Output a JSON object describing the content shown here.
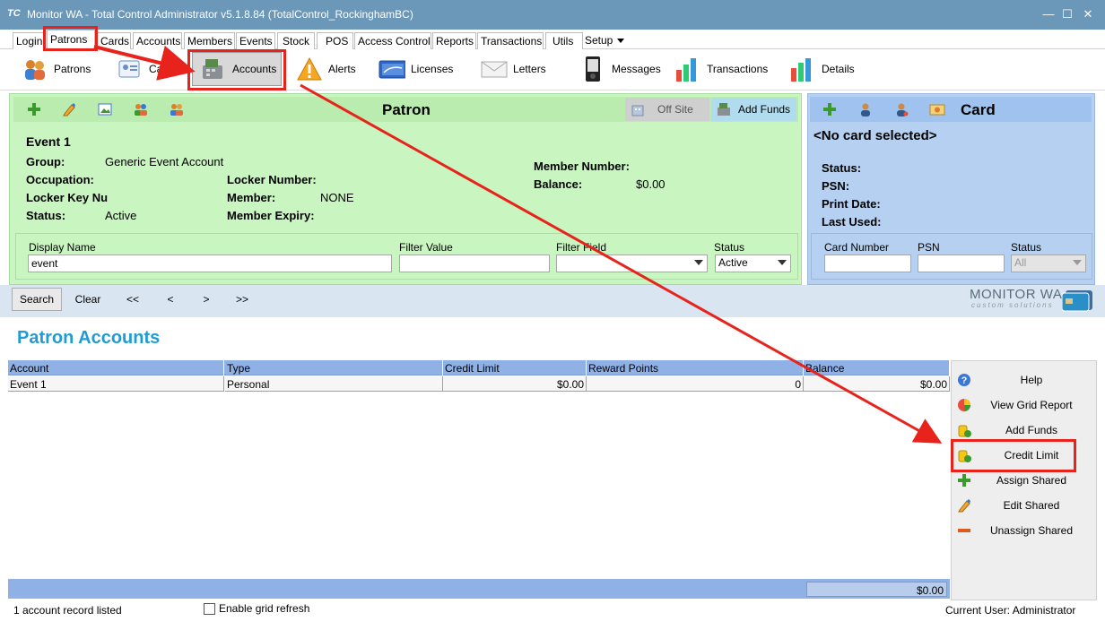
{
  "window": {
    "logo": "TC",
    "title": "Monitor WA - Total Control Administrator v5.1.8.84 (TotalControl_RockinghamBC)"
  },
  "menu_tabs": [
    "Login",
    "Patrons",
    "Cards",
    "Accounts",
    "Members",
    "Events",
    "Stock",
    "POS",
    "Access Control",
    "Reports",
    "Transactions",
    "Utils",
    "Setup"
  ],
  "toolbar": {
    "patrons": "Patrons",
    "cards": "Cards",
    "accounts": "Accounts",
    "alerts": "Alerts",
    "licenses": "Licenses",
    "letters": "Letters",
    "messages": "Messages",
    "transactions": "Transactions",
    "details": "Details"
  },
  "patron": {
    "heading": "Patron",
    "offsite": "Off Site",
    "add_funds": "Add Funds",
    "name": "Event 1",
    "group_label": "Group:",
    "group_value": "Generic Event Account",
    "occupation_label": "Occupation:",
    "locker_key_label": "Locker Key Nu",
    "status_label": "Status:",
    "status_value": "Active",
    "locker_number_label": "Locker Number:",
    "member_label": "Member:",
    "member_value": "NONE",
    "member_expiry_label": "Member Expiry:",
    "member_number_label": "Member Number:",
    "balance_label": "Balance:",
    "balance_value": "$0.00"
  },
  "filters": {
    "display_name_label": "Display Name",
    "display_name_value": "event",
    "filter_value_label": "Filter Value",
    "filter_field_label": "Filter Field",
    "status_label": "Status",
    "status_value": "Active"
  },
  "card": {
    "heading": "Card",
    "no_card": "<No card selected>",
    "status_label": "Status:",
    "psn_label": "PSN:",
    "print_date_label": "Print Date:",
    "last_used_label": "Last Used:",
    "card_number_label": "Card Number",
    "psn_field_label": "PSN",
    "status_field_label": "Status",
    "status_field_value": "All"
  },
  "search": {
    "search": "Search",
    "clear": "Clear",
    "first": "<<",
    "prev": "<",
    "next": ">",
    "last": ">>"
  },
  "brand": {
    "name": "MONITOR WA",
    "tagline": "custom solutions"
  },
  "section_title": "Patron Accounts",
  "grid": {
    "columns": [
      "Account",
      "Type",
      "Credit Limit",
      "Reward Points",
      "Balance"
    ],
    "rows": [
      [
        "Event 1",
        "Personal",
        "$0.00",
        "0",
        "$0.00"
      ]
    ],
    "total_balance": "$0.00"
  },
  "side_actions": [
    "Help",
    "View Grid Report",
    "Add Funds",
    "Credit Limit",
    "Assign Shared",
    "Edit Shared",
    "Unassign Shared"
  ],
  "status_bar": {
    "records": "1 account record listed",
    "grid_refresh": "Enable grid refresh",
    "user": "Current User: Administrator"
  },
  "colors": {
    "titlebar": "#6b97b8",
    "patron_panel": "#c9f5c0",
    "card_panel": "#b5d0f0",
    "grid_header": "#8fb1e6",
    "section_title": "#1f9bd6",
    "annotation": "#e8231c"
  }
}
